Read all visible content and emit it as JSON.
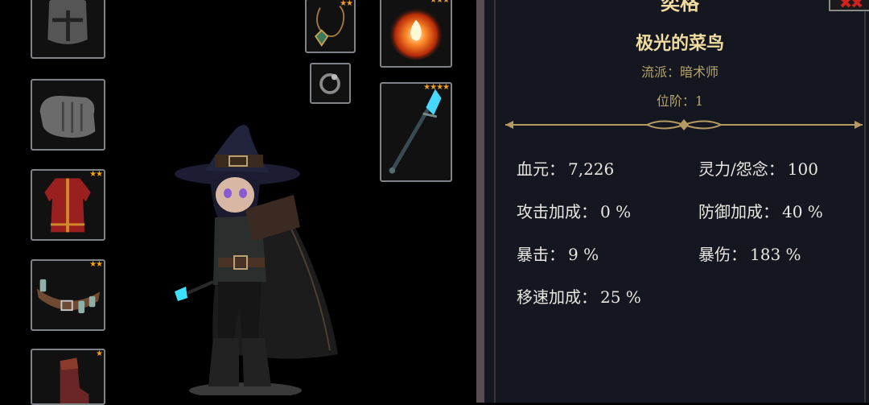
{
  "panel": {
    "title": "奕格",
    "name": "极光的菜鸟",
    "school_label": "流派：",
    "school": "暗术师",
    "rank_label": "位阶：",
    "rank": "1"
  },
  "stats": [
    {
      "label": "血元：",
      "value": "7,226"
    },
    {
      "label": "灵力/怨念：",
      "value": "100"
    },
    {
      "label": "攻击加成：",
      "value": "0 %"
    },
    {
      "label": "防御加成：",
      "value": "40 %"
    },
    {
      "label": "暴击：",
      "value": "9 %"
    },
    {
      "label": "暴伤：",
      "value": "183 %"
    },
    {
      "label": "移速加成：",
      "value": "25 %"
    }
  ],
  "equipment": {
    "helmet": {
      "stars": ""
    },
    "gloves": {
      "stars": ""
    },
    "robe": {
      "stars": "★★"
    },
    "belt": {
      "stars": "★★"
    },
    "boots": {
      "stars": "★"
    },
    "necklace": {
      "stars": "★★"
    },
    "ring": {
      "stars": ""
    },
    "fire_orb": {
      "stars": "★★★"
    },
    "staff": {
      "stars": "★★★★"
    }
  },
  "colors": {
    "star": "#f2a11c",
    "title_gold": "#f0dc9e",
    "panel_bg": "#151720",
    "panel_border": "#5b4c54"
  }
}
